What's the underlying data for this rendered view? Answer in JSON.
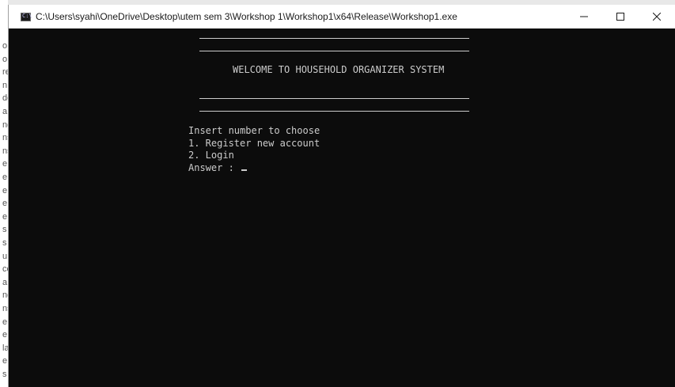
{
  "background_window": {
    "visible_fragments": [
      "oı",
      "o",
      "re",
      "n",
      "de",
      "a",
      "ng",
      "ns",
      "ns",
      "e",
      "e",
      "e",
      "e",
      "e",
      "s",
      "s",
      "u",
      "ce",
      "a",
      "ng",
      "ns",
      "e",
      "e",
      "la",
      "e",
      "s"
    ]
  },
  "window": {
    "title": "C:\\Users\\syahi\\OneDrive\\Desktop\\utem sem 3\\Workshop 1\\Workshop1\\x64\\Release\\Workshop1.exe",
    "app_icon_glyph": "C:\\",
    "controls": {
      "minimize": "minimize-icon",
      "maximize": "maximize-icon",
      "close": "close-icon"
    }
  },
  "console": {
    "banner": "WELCOME TO HOUSEHOLD ORGANIZER SYSTEM",
    "prompt_heading": "Insert number to choose",
    "option_1": "1. Register new account",
    "option_2": "2. Login",
    "answer_prompt": "Answer : ",
    "colors": {
      "background": "#0c0c0c",
      "text": "#cccccc"
    }
  }
}
